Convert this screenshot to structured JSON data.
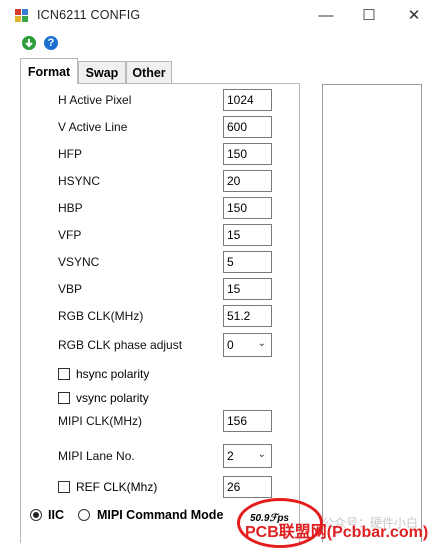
{
  "window": {
    "title": "ICN6211 CONFIG",
    "minimize": "—",
    "maximize": "☐",
    "close": "✕"
  },
  "toolbar": {
    "download_icon": "download-icon",
    "help_icon": "help-icon"
  },
  "tabs": [
    {
      "label": "Format",
      "active": true
    },
    {
      "label": "Swap",
      "active": false
    },
    {
      "label": "Other",
      "active": false
    }
  ],
  "fields": {
    "h_active_pixel": {
      "label": "H Active Pixel",
      "value": "1024"
    },
    "v_active_line": {
      "label": "V Active Line",
      "value": "600"
    },
    "hfp": {
      "label": "HFP",
      "value": "150"
    },
    "hsync": {
      "label": "HSYNC",
      "value": "20"
    },
    "hbp": {
      "label": "HBP",
      "value": "150"
    },
    "vfp": {
      "label": "VFP",
      "value": "15"
    },
    "vsync": {
      "label": "VSYNC",
      "value": "5"
    },
    "vbp": {
      "label": "VBP",
      "value": "15"
    },
    "rgb_clk": {
      "label": "RGB CLK(MHz)",
      "value": "51.2"
    },
    "rgb_clk_phase": {
      "label": "RGB CLK phase adjust",
      "value": "0"
    },
    "mipi_clk": {
      "label": "MIPI CLK(MHz)",
      "value": "156"
    },
    "mipi_lane": {
      "label": "MIPI Lane No.",
      "value": "2"
    },
    "ref_clk": {
      "label": "REF CLK(Mhz)",
      "value": "26"
    }
  },
  "checkboxes": {
    "hsync_polarity": {
      "label": "hsync polarity",
      "checked": false
    },
    "vsync_polarity": {
      "label": "vsync polarity",
      "checked": false
    },
    "ref_clk": {
      "checked": false
    }
  },
  "mode": {
    "iic": {
      "label": "IIC",
      "selected": true
    },
    "mipi_command": {
      "label": "MIPI Command Mode",
      "selected": false
    }
  },
  "overlay": {
    "stamp_text": "50.9ℱps",
    "watermark": "PCB联盟网(Pcbbar.com)",
    "watermark_faint": "公众号：硬件小白"
  },
  "colors": {
    "stamp_red": "#e51c1c",
    "green_icon": "#2e9e3a",
    "blue_icon": "#1a6fd1"
  }
}
